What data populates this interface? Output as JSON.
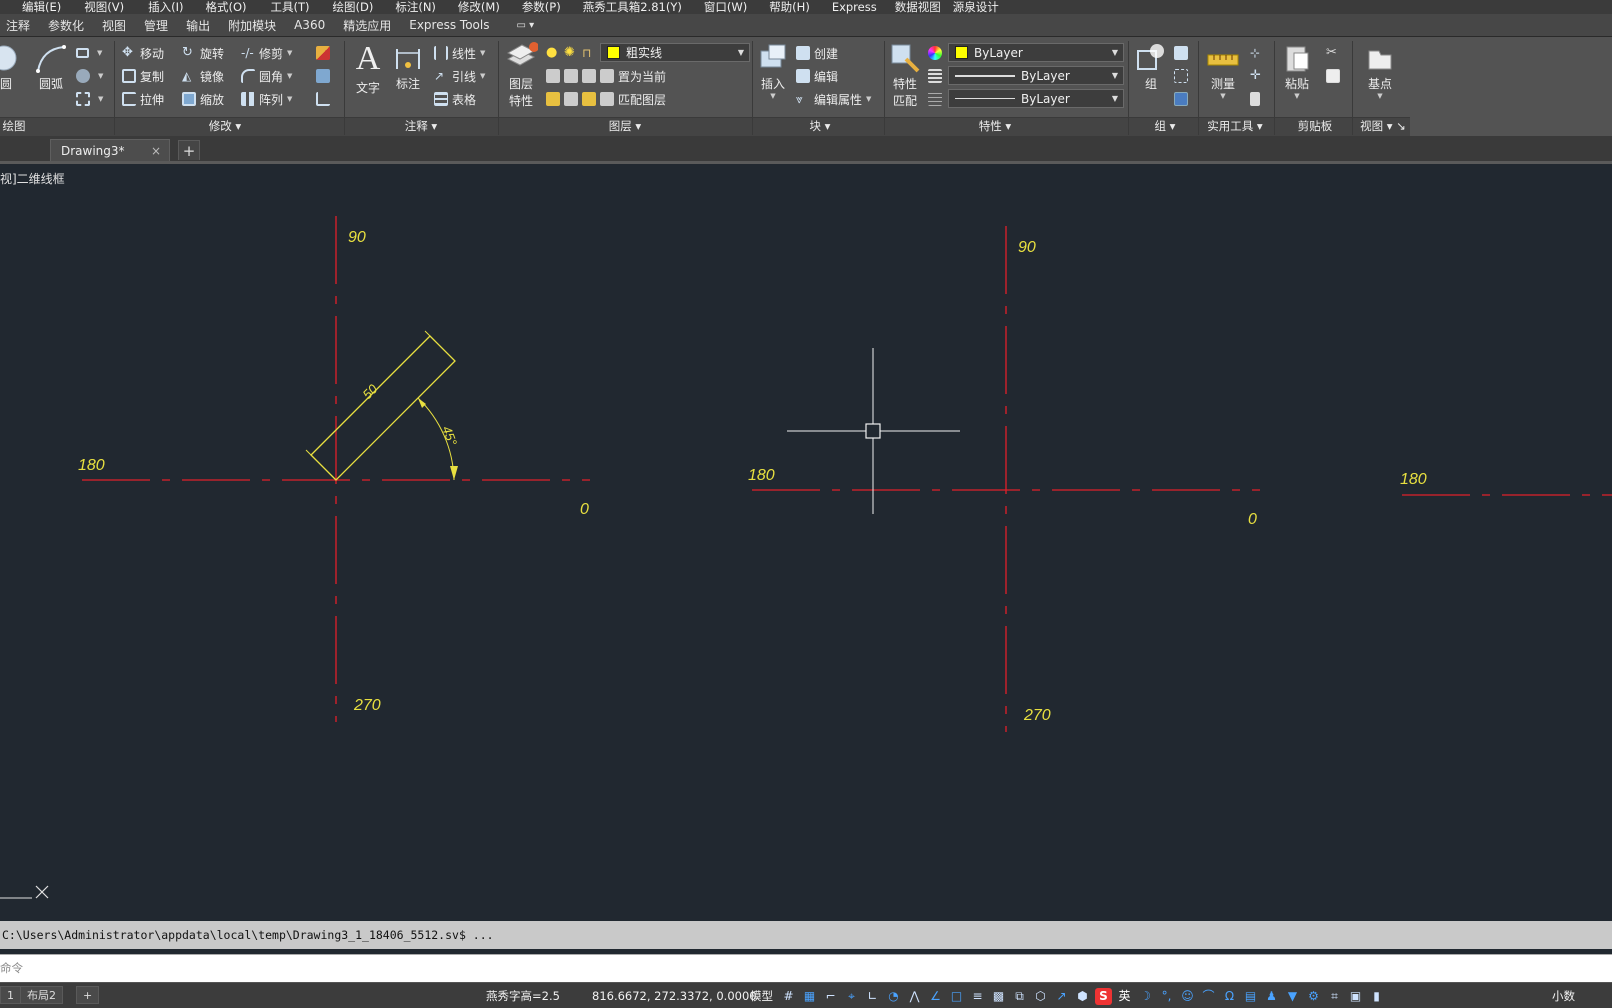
{
  "menubar": {
    "items": [
      "编辑(E)",
      "视图(V)",
      "插入(I)",
      "格式(O)",
      "工具(T)",
      "绘图(D)",
      "标注(N)",
      "修改(M)",
      "参数(P)",
      "燕秀工具箱2.81(Y)",
      "窗口(W)",
      "帮助(H)",
      "Express",
      "数据视图",
      "源泉设计"
    ]
  },
  "ribbon_tabs": [
    "注释",
    "参数化",
    "视图",
    "管理",
    "输出",
    "附加模块",
    "A360",
    "精选应用",
    "Express Tools"
  ],
  "ribbon": {
    "draw": {
      "circle": "圆",
      "arc": "圆弧",
      "title": "绘图"
    },
    "modify": {
      "title": "修改",
      "move": "移动",
      "rotate": "旋转",
      "trim": "修剪",
      "copy": "复制",
      "mirror": "镜像",
      "fillet": "圆角",
      "stretch": "拉伸",
      "scale": "缩放",
      "array": "阵列"
    },
    "annotation": {
      "title": "注释",
      "text": "文字",
      "dimension": "标注",
      "linear": "线性",
      "leader": "引线",
      "table": "表格"
    },
    "layers": {
      "title": "图层",
      "layer_properties_line1": "图层",
      "layer_properties_line2": "特性",
      "current_layer": "粗实线",
      "make_current": "置为当前",
      "match_layer": "匹配图层"
    },
    "block": {
      "title": "块",
      "insert": "插入",
      "create": "创建",
      "edit": "编辑",
      "edit_attributes": "编辑属性"
    },
    "properties": {
      "title": "特性",
      "match_line1": "特性",
      "match_line2": "匹配",
      "color": "ByLayer",
      "linetype": "ByLayer",
      "lineweight": "ByLayer"
    },
    "groups": {
      "title": "组",
      "group": "组"
    },
    "utilities": {
      "title": "实用工具",
      "measure": "测量"
    },
    "clipboard": {
      "title": "剪贴板",
      "paste": "粘贴"
    },
    "view": {
      "title": "视图",
      "base_point": "基点"
    }
  },
  "file_tabs": {
    "active": "Drawing3*",
    "close": "×",
    "add": "+"
  },
  "canvas": {
    "view_label": "视]二维线框",
    "drawing_left": {
      "label_90": "90",
      "label_180": "180",
      "label_270": "270",
      "label_0": "0",
      "dim_length": "50",
      "dim_angle": "45°"
    },
    "drawing_right": {
      "label_90": "90",
      "label_180": "180",
      "label_270": "270",
      "label_0": "0"
    },
    "drawing_far_right": {
      "label_180": "180"
    }
  },
  "command": {
    "history": "C:\\Users\\Administrator\\appdata\\local\\temp\\Drawing3_1_18406_5512.sv$ ...",
    "placeholder": "命令"
  },
  "statusbar": {
    "layout_tab_1": "1",
    "layout_tab_2": "布局2",
    "add_layout": "+",
    "text_height": "燕秀字高=2.5",
    "coordinates": "816.6672, 272.3372, 0.0000",
    "model": "模型",
    "ime_lang": "英",
    "decimal": "小数"
  },
  "colors": {
    "axis_red": "#e0202a",
    "drawing_yellow": "#e8e040",
    "canvas_bg": "#212830"
  }
}
